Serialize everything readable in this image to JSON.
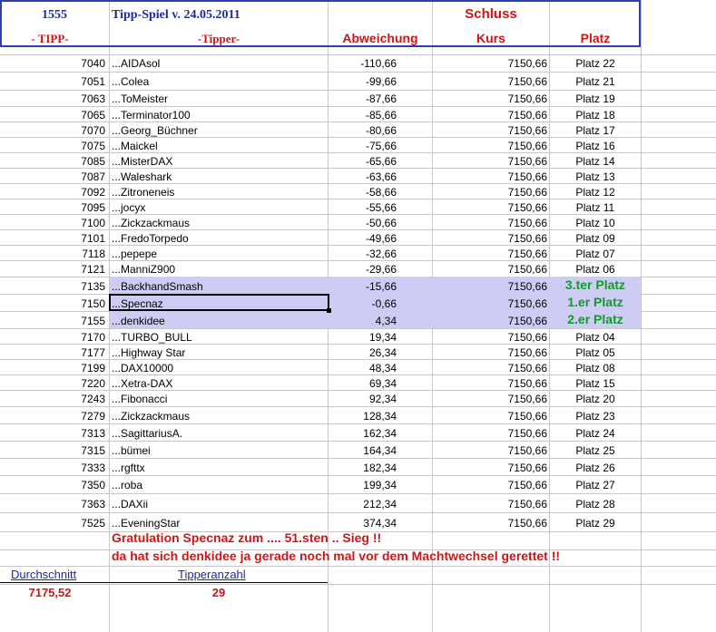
{
  "header": {
    "id": "1555",
    "title": "Tipp-Spiel v. 24.05.2011",
    "schluss": "Schluss",
    "col_tipp": "- TIPP-",
    "col_tipper": "-Tipper-",
    "col_abweichung": "Abweichung",
    "col_kurs": "Kurs",
    "col_platz": "Platz"
  },
  "rows": [
    {
      "tipp": "7040",
      "name": "...AIDAsol",
      "abw": "-110,66",
      "kurs": "7150,66",
      "platz": "Platz 22"
    },
    {
      "tipp": "7051",
      "name": "...Colea",
      "abw": "-99,66",
      "kurs": "7150,66",
      "platz": "Platz 21"
    },
    {
      "tipp": "7063",
      "name": "...ToMeister",
      "abw": "-87,66",
      "kurs": "7150,66",
      "platz": "Platz 19"
    },
    {
      "tipp": "7065",
      "name": "...Terminator100",
      "abw": "-85,66",
      "kurs": "7150,66",
      "platz": "Platz 18"
    },
    {
      "tipp": "7070",
      "name": "...Georg_Büchner",
      "abw": "-80,66",
      "kurs": "7150,66",
      "platz": "Platz 17"
    },
    {
      "tipp": "7075",
      "name": "...Maickel",
      "abw": "-75,66",
      "kurs": "7150,66",
      "platz": "Platz 16"
    },
    {
      "tipp": "7085",
      "name": "...MisterDAX",
      "abw": "-65,66",
      "kurs": "7150,66",
      "platz": "Platz 14"
    },
    {
      "tipp": "7087",
      "name": "...Waleshark",
      "abw": "-63,66",
      "kurs": "7150,66",
      "platz": "Platz 13"
    },
    {
      "tipp": "7092",
      "name": "...Zitroneneis",
      "abw": "-58,66",
      "kurs": "7150,66",
      "platz": "Platz 12"
    },
    {
      "tipp": "7095",
      "name": "...jocyx",
      "abw": "-55,66",
      "kurs": "7150,66",
      "platz": "Platz 11"
    },
    {
      "tipp": "7100",
      "name": "...Zickzackmaus",
      "abw": "-50,66",
      "kurs": "7150,66",
      "platz": "Platz 10"
    },
    {
      "tipp": "7101",
      "name": "...FredoTorpedo",
      "abw": "-49,66",
      "kurs": "7150,66",
      "platz": "Platz 09"
    },
    {
      "tipp": "7118",
      "name": "...pepepe",
      "abw": "-32,66",
      "kurs": "7150,66",
      "platz": "Platz 07"
    },
    {
      "tipp": "7121",
      "name": "...ManniZ900",
      "abw": "-29,66",
      "kurs": "7150,66",
      "platz": "Platz 06"
    },
    {
      "tipp": "7135",
      "name": "...BackhandSmash",
      "abw": "-15,66",
      "kurs": "7150,66",
      "platz": "3.ter Platz",
      "winner": true
    },
    {
      "tipp": "7150",
      "name": "...Specnaz",
      "abw": "-0,66",
      "kurs": "7150,66",
      "platz": "1.er Platz",
      "winner": true
    },
    {
      "tipp": "7155",
      "name": "...denkidee",
      "abw": "4,34",
      "kurs": "7150,66",
      "platz": "2.er Platz",
      "winner": true
    },
    {
      "tipp": "7170",
      "name": "...TURBO_BULL",
      "abw": "19,34",
      "kurs": "7150,66",
      "platz": "Platz 04"
    },
    {
      "tipp": "7177",
      "name": "...Highway Star",
      "abw": "26,34",
      "kurs": "7150,66",
      "platz": "Platz 05"
    },
    {
      "tipp": "7199",
      "name": "...DAX10000",
      "abw": "48,34",
      "kurs": "7150,66",
      "platz": "Platz 08"
    },
    {
      "tipp": "7220",
      "name": "...Xetra-DAX",
      "abw": "69,34",
      "kurs": "7150,66",
      "platz": "Platz 15"
    },
    {
      "tipp": "7243",
      "name": "...Fibonacci",
      "abw": "92,34",
      "kurs": "7150,66",
      "platz": "Platz 20"
    },
    {
      "tipp": "7279",
      "name": "...Zickzackmaus",
      "abw": "128,34",
      "kurs": "7150,66",
      "platz": "Platz 23"
    },
    {
      "tipp": "7313",
      "name": "...SagittariusA.",
      "abw": "162,34",
      "kurs": "7150,66",
      "platz": "Platz 24"
    },
    {
      "tipp": "7315",
      "name": "...bümei",
      "abw": "164,34",
      "kurs": "7150,66",
      "platz": "Platz 25"
    },
    {
      "tipp": "7333",
      "name": "...rgfttx",
      "abw": "182,34",
      "kurs": "7150,66",
      "platz": "Platz 26"
    },
    {
      "tipp": "7350",
      "name": "...roba",
      "abw": "199,34",
      "kurs": "7150,66",
      "platz": "Platz 27"
    },
    {
      "tipp": "7363",
      "name": "...DAXii",
      "abw": "212,34",
      "kurs": "7150,66",
      "platz": "Platz 28"
    },
    {
      "tipp": "7525",
      "name": "...EveningStar",
      "abw": "374,34",
      "kurs": "7150,66",
      "platz": "Platz 29"
    }
  ],
  "footer": {
    "line1": "Gratulation Specnaz zum ....    51.sten .. Sieg !!",
    "line2": "da hat sich denkidee ja gerade noch mal vor dem Machtwechsel gerettet !!",
    "avg_label": "Durchschnitt",
    "avg_value": "7175,52",
    "count_label": "Tipperanzahl",
    "count_value": "29"
  },
  "colors": {
    "header_blue": "#1b2aa5",
    "red": "#d01515",
    "winner_green": "#129a2a",
    "winner_bg": "#ccccf5"
  }
}
